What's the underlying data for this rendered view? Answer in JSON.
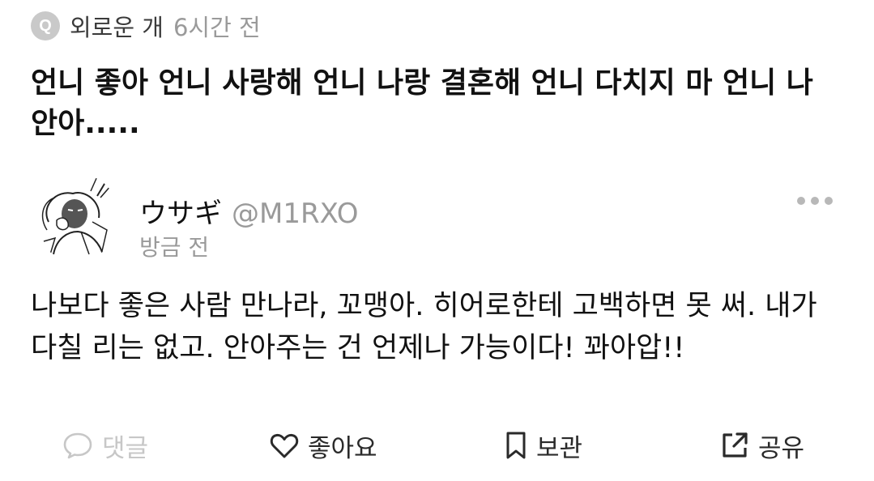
{
  "question": {
    "badge": "Q",
    "author": "외로운 개",
    "time": "6시간 전",
    "text": "언니 좋아 언니 사랑해 언니 나랑 결혼해 언니 다치지 마 언니 나 안아....."
  },
  "answer": {
    "display_name": "ウサギ",
    "handle": "@M1RXO",
    "time": "방금 전",
    "text": "나보다 좋은 사람 만나라, 꼬맹아. 히어로한테 고백하면 못 써. 내가 다칠 리는 없고. 안아주는 건 언제나 가능이다! 꽈아압!!"
  },
  "actions": {
    "comment": "댓글",
    "like": "좋아요",
    "save": "보관",
    "share": "공유"
  },
  "icons": {
    "comment": "comment-bubble-icon",
    "like": "heart-icon",
    "save": "bookmark-icon",
    "share": "share-icon",
    "more": "more-horizontal-icon"
  },
  "colors": {
    "primary_text": "#111111",
    "secondary_text": "#9a9a9a",
    "disabled": "#c7c7c7",
    "badge": "#c9c9c9"
  }
}
